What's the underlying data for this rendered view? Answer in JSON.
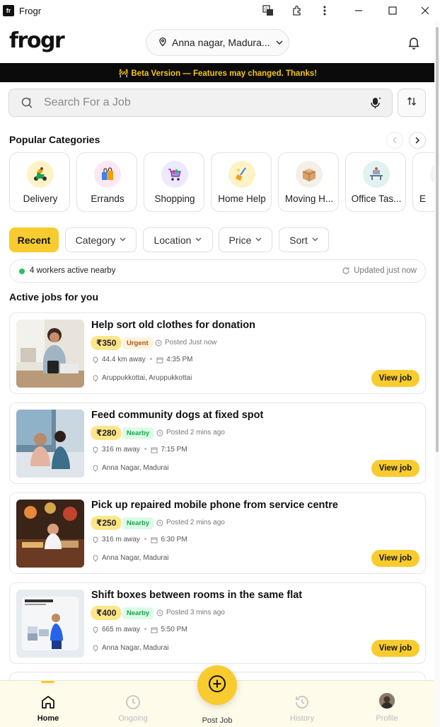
{
  "window": {
    "app_icon_text": "fr",
    "title": "Frogr"
  },
  "header": {
    "logo": "frogr",
    "location": "Anna nagar, Madura..."
  },
  "banner": {
    "text": "🚧 Beta Version — Features may changed. Thanks!"
  },
  "search": {
    "placeholder": "Search For a Job"
  },
  "categories": {
    "title": "Popular Categories",
    "items": [
      {
        "label": "Delivery",
        "icon": "delivery-scooter-icon",
        "bg": "#fef3c7"
      },
      {
        "label": "Errands",
        "icon": "shopping-bag-icon",
        "bg": "#fce7f3"
      },
      {
        "label": "Shopping",
        "icon": "shopping-cart-icon",
        "bg": "#ede9fe"
      },
      {
        "label": "Home Help",
        "icon": "broom-icon",
        "bg": "#fef3c7"
      },
      {
        "label": "Moving H...",
        "icon": "box-icon",
        "bg": "#f5efe6"
      },
      {
        "label": "Office Tas...",
        "icon": "office-desk-icon",
        "bg": "#e0f2f1"
      },
      {
        "label": "E",
        "icon": "event-icon",
        "bg": "#f3f4f6"
      }
    ]
  },
  "filters": [
    {
      "label": "Recent",
      "active": true
    },
    {
      "label": "Category",
      "active": false
    },
    {
      "label": "Location",
      "active": false
    },
    {
      "label": "Price",
      "active": false
    },
    {
      "label": "Sort",
      "active": false
    }
  ],
  "status": {
    "workers": "4 workers active nearby",
    "updated": "Updated just now"
  },
  "jobs_title": "Active jobs for you",
  "jobs": [
    {
      "title": "Help sort old clothes for donation",
      "price": "₹350",
      "tag": "Urgent",
      "posted": "Posted Just now",
      "distance": "44.4 km away",
      "time": "4:35 PM",
      "address": "Aruppukkottai, Aruppukkottai",
      "button": "View job"
    },
    {
      "title": "Feed community dogs at fixed spot",
      "price": "₹280",
      "tag": "Nearby",
      "posted": "Posted 2 mins ago",
      "distance": "316 m away",
      "time": "7:15 PM",
      "address": "Anna Nagar, Madurai",
      "button": "View job"
    },
    {
      "title": "Pick up repaired mobile phone from service centre",
      "price": "₹250",
      "tag": "Nearby",
      "posted": "Posted 2 mins ago",
      "distance": "316 m away",
      "time": "6:30 PM",
      "address": "Anna Nagar, Madurai",
      "button": "View job"
    },
    {
      "title": "Shift boxes between rooms in the same flat",
      "price": "₹400",
      "tag": "Nearby",
      "posted": "Posted 3 mins ago",
      "distance": "665 m away",
      "time": "5:50 PM",
      "address": "Anna Nagar, Madurai",
      "button": "View job"
    }
  ],
  "nav": {
    "home": "Home",
    "ongoing": "Ongoing",
    "post": "Post Job",
    "history": "History",
    "profile": "Profile"
  },
  "colors": {
    "accent": "#f8cb2e",
    "banner_bg": "#0b0b0b",
    "banner_text": "#f5c518",
    "nearby": "#16a34a",
    "urgent": "#b45309"
  }
}
